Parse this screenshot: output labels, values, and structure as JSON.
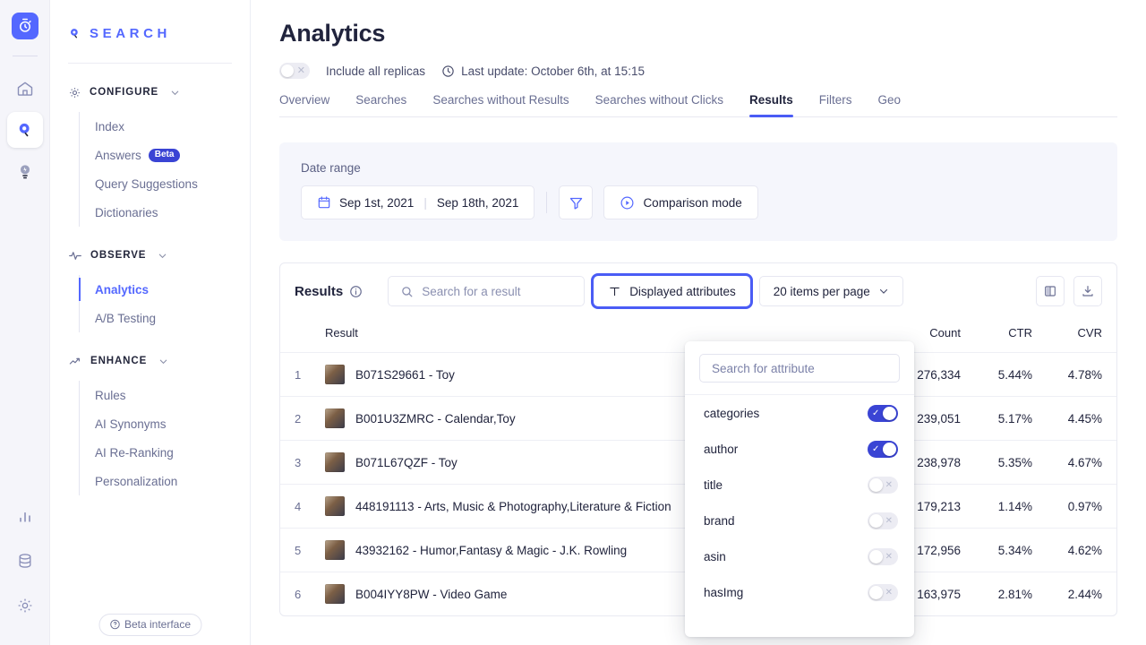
{
  "rail": {
    "logo_icon": "stopwatch-logo-icon",
    "items": [
      {
        "icon": "home-icon",
        "name": "home"
      },
      {
        "icon": "search-pin-icon",
        "name": "search",
        "active": true
      },
      {
        "icon": "lightbulb-icon",
        "name": "recommend"
      }
    ],
    "bottom_items": [
      {
        "icon": "bar-chart-icon",
        "name": "analytics"
      },
      {
        "icon": "database-icon",
        "name": "data-sources"
      },
      {
        "icon": "gear-icon",
        "name": "settings"
      }
    ]
  },
  "sidebar": {
    "brand": "SEARCH",
    "brand_icon": "search-pin-icon",
    "groups": [
      {
        "label": "CONFIGURE",
        "icon": "gear-icon",
        "items": [
          {
            "label": "Index"
          },
          {
            "label": "Answers",
            "badge": "Beta"
          },
          {
            "label": "Query Suggestions"
          },
          {
            "label": "Dictionaries"
          }
        ]
      },
      {
        "label": "OBSERVE",
        "icon": "pulse-icon",
        "items": [
          {
            "label": "Analytics",
            "active": true
          },
          {
            "label": "A/B Testing"
          }
        ]
      },
      {
        "label": "ENHANCE",
        "icon": "trending-up-icon",
        "items": [
          {
            "label": "Rules"
          },
          {
            "label": "AI Synonyms"
          },
          {
            "label": "AI Re-Ranking"
          },
          {
            "label": "Personalization"
          }
        ]
      }
    ],
    "beta_pill": "Beta interface"
  },
  "header": {
    "title": "Analytics",
    "replicas_toggle_label": "Include all replicas",
    "replicas_toggle_state": "off",
    "last_update": "Last update: October 6th, at 15:15",
    "clock_icon": "clock-icon"
  },
  "tabs": [
    {
      "label": "Overview",
      "active": false
    },
    {
      "label": "Searches",
      "active": false
    },
    {
      "label": "Searches without Results",
      "active": false
    },
    {
      "label": "Searches without Clicks",
      "active": false
    },
    {
      "label": "Results",
      "active": true
    },
    {
      "label": "Filters",
      "active": false
    },
    {
      "label": "Geo",
      "active": false
    }
  ],
  "date_range": {
    "label": "Date range",
    "start": "Sep 1st, 2021",
    "end": "Sep 18th, 2021",
    "calendar_icon": "calendar-icon",
    "filter_icon": "funnel-icon",
    "comparison_label": "Comparison mode",
    "comparison_icon": "play-circle-icon"
  },
  "results": {
    "title": "Results",
    "info_icon": "info-icon",
    "search_placeholder": "Search for a result",
    "search_value": "",
    "search_icon": "search-icon",
    "displayed_attributes_label": "Displayed attributes",
    "displayed_attributes_icon": "text-type-icon",
    "items_per_page": "20 items per page",
    "chevron_icon": "chevron-down-icon",
    "columns_icon": "columns-layout-icon",
    "download_icon": "download-icon",
    "headers": {
      "result": "Result",
      "count": "Count",
      "ctr": "CTR",
      "cvr": "CVR"
    },
    "rows": [
      {
        "rank": "1",
        "result": "B071S29661 - Toy",
        "count": "276,334",
        "ctr": "5.44%",
        "cvr": "4.78%"
      },
      {
        "rank": "2",
        "result": "B001U3ZMRC - Calendar,Toy",
        "count": "239,051",
        "ctr": "5.17%",
        "cvr": "4.45%"
      },
      {
        "rank": "3",
        "result": "B071L67QZF - Toy",
        "count": "238,978",
        "ctr": "5.35%",
        "cvr": "4.67%"
      },
      {
        "rank": "4",
        "result": "448191113 - Arts, Music & Photography,Literature & Fiction",
        "count": "179,213",
        "ctr": "1.14%",
        "cvr": "0.97%"
      },
      {
        "rank": "5",
        "result": "43932162 - Humor,Fantasy & Magic - J.K. Rowling",
        "count": "172,956",
        "ctr": "5.34%",
        "cvr": "4.62%"
      },
      {
        "rank": "6",
        "result": "B004IYY8PW - Video Game",
        "count": "163,975",
        "ctr": "2.81%",
        "cvr": "2.44%"
      }
    ]
  },
  "attributes_popover": {
    "search_placeholder": "Search for attribute",
    "search_value": "",
    "items": [
      {
        "label": "categories",
        "state": "on"
      },
      {
        "label": "author",
        "state": "on"
      },
      {
        "label": "title",
        "state": "off"
      },
      {
        "label": "brand",
        "state": "off"
      },
      {
        "label": "asin",
        "state": "off"
      },
      {
        "label": "hasImg",
        "state": "off"
      }
    ]
  },
  "colors": {
    "accent": "#5468ff",
    "accent_dark": "#3a44d4",
    "focus_ring": "#4a5cf5",
    "text": "#21243d",
    "muted": "#6a6f93",
    "panel_bg": "#f5f6fc"
  }
}
